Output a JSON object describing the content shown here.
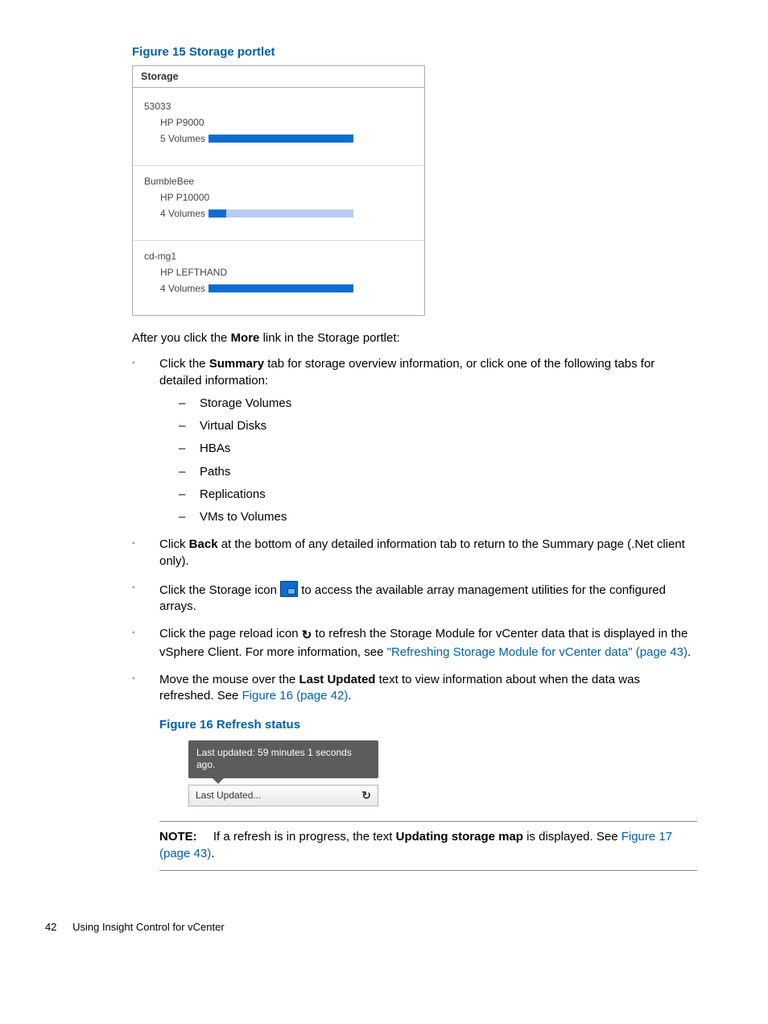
{
  "figure15": {
    "caption": "Figure 15 Storage portlet",
    "portlet_title": "Storage",
    "arrays": [
      {
        "name": "53033",
        "model": "HP P9000",
        "volumes_label": "5 Volumes",
        "fill_pct": 100
      },
      {
        "name": "BumbleBee",
        "model": "HP P10000",
        "volumes_label": "4 Volumes",
        "fill_pct": 12
      },
      {
        "name": "cd-mg1",
        "model": "HP LEFTHAND",
        "volumes_label": "4 Volumes",
        "fill_pct": 100
      }
    ]
  },
  "intro": {
    "pre": "After you click the ",
    "bold": "More",
    "post": " link in the Storage portlet:"
  },
  "bullets": {
    "summary": {
      "pre": "Click the ",
      "bold": "Summary",
      "post": " tab for storage overview information, or click one of the following tabs for detailed information:",
      "tabs": [
        "Storage Volumes",
        "Virtual Disks",
        "HBAs",
        "Paths",
        "Replications",
        "VMs to Volumes"
      ]
    },
    "back": {
      "pre": "Click ",
      "bold": "Back",
      "post": " at the bottom of any detailed information tab to return to the Summary page (.Net client only)."
    },
    "storage_icon": {
      "pre": "Click the Storage icon ",
      "post": " to access the available array management utilities for the configured arrays."
    },
    "reload": {
      "pre": "Click the page reload icon ",
      "mid": " to refresh the Storage Module for vCenter data that is displayed in the vSphere Client. For more information, see ",
      "link": "\"Refreshing Storage Module for vCenter data\" (page 43)",
      "post": "."
    },
    "last_updated": {
      "pre": "Move the mouse over the ",
      "bold": "Last Updated",
      "mid": " text to view information about when the data was refreshed. See ",
      "link": "Figure 16 (page 42)",
      "post": "."
    }
  },
  "figure16": {
    "caption": "Figure 16 Refresh status",
    "tooltip": "Last updated: 59 minutes 1 seconds ago.",
    "status_text": "Last Updated...",
    "reload_glyph": "↻"
  },
  "note": {
    "label": "NOTE:",
    "pre": "If a refresh is in progress, the text ",
    "bold": "Updating storage map",
    "mid": " is displayed. See ",
    "link": "Figure 17 (page 43)",
    "post": "."
  },
  "footer": {
    "page": "42",
    "section": "Using Insight Control for vCenter"
  }
}
